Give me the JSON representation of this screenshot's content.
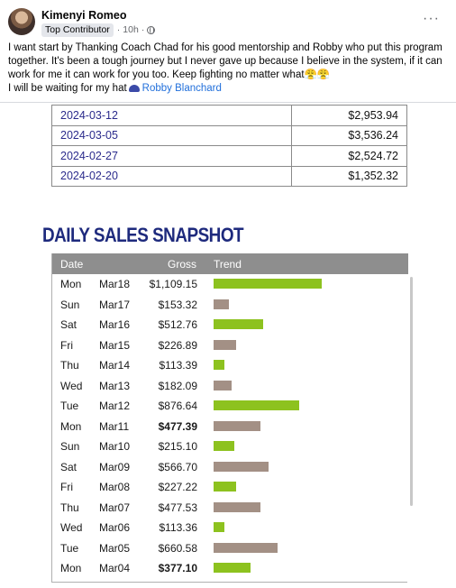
{
  "post": {
    "author": "Kimenyi Romeo",
    "badge": "Top Contributor",
    "time": "10h",
    "separator": "·",
    "text_line1": "I want start by Thanking Coach Chad for his good mentorship and Robby who put this program together. It's been a tough journey but I never gave up because I believe in the system, if it can work for me it can work for you too. Keep fighting no matter what😤😤",
    "text_line2_prefix": "I will be waiting for my hat",
    "mention": "Robby Blanchard",
    "more": "···"
  },
  "weekly_table": [
    {
      "date": "2024-03-12",
      "amount": "$2,953.94"
    },
    {
      "date": "2024-03-05",
      "amount": "$3,536.24"
    },
    {
      "date": "2024-02-27",
      "amount": "$2,524.72"
    },
    {
      "date": "2024-02-20",
      "amount": "$1,352.32"
    }
  ],
  "snapshot": {
    "title": "DAILY SALES SNAPSHOT",
    "headers": {
      "date": "Date",
      "gross": "Gross",
      "trend": "Trend"
    },
    "colors": {
      "up": "#8dc21f",
      "down": "#a39085"
    },
    "rows": [
      {
        "day": "Mon",
        "date": "Mar18",
        "gross": "$1,109.15",
        "value": 1109.15,
        "trend": "up",
        "bold": false
      },
      {
        "day": "Sun",
        "date": "Mar17",
        "gross": "$153.32",
        "value": 153.32,
        "trend": "down",
        "bold": false
      },
      {
        "day": "Sat",
        "date": "Mar16",
        "gross": "$512.76",
        "value": 512.76,
        "trend": "up",
        "bold": false
      },
      {
        "day": "Fri",
        "date": "Mar15",
        "gross": "$226.89",
        "value": 226.89,
        "trend": "down",
        "bold": false
      },
      {
        "day": "Thu",
        "date": "Mar14",
        "gross": "$113.39",
        "value": 113.39,
        "trend": "up",
        "bold": false
      },
      {
        "day": "Wed",
        "date": "Mar13",
        "gross": "$182.09",
        "value": 182.09,
        "trend": "down",
        "bold": false
      },
      {
        "day": "Tue",
        "date": "Mar12",
        "gross": "$876.64",
        "value": 876.64,
        "trend": "up",
        "bold": false
      },
      {
        "day": "Mon",
        "date": "Mar11",
        "gross": "$477.39",
        "value": 477.39,
        "trend": "down",
        "bold": true
      },
      {
        "day": "Sun",
        "date": "Mar10",
        "gross": "$215.10",
        "value": 215.1,
        "trend": "up",
        "bold": false
      },
      {
        "day": "Sat",
        "date": "Mar09",
        "gross": "$566.70",
        "value": 566.7,
        "trend": "down",
        "bold": false
      },
      {
        "day": "Fri",
        "date": "Mar08",
        "gross": "$227.22",
        "value": 227.22,
        "trend": "up",
        "bold": false
      },
      {
        "day": "Thu",
        "date": "Mar07",
        "gross": "$477.53",
        "value": 477.53,
        "trend": "down",
        "bold": false
      },
      {
        "day": "Wed",
        "date": "Mar06",
        "gross": "$113.36",
        "value": 113.36,
        "trend": "up",
        "bold": false
      },
      {
        "day": "Tue",
        "date": "Mar05",
        "gross": "$660.58",
        "value": 660.58,
        "trend": "down",
        "bold": false
      },
      {
        "day": "Mon",
        "date": "Mar04",
        "gross": "$377.10",
        "value": 377.1,
        "trend": "up",
        "bold": true
      }
    ]
  }
}
